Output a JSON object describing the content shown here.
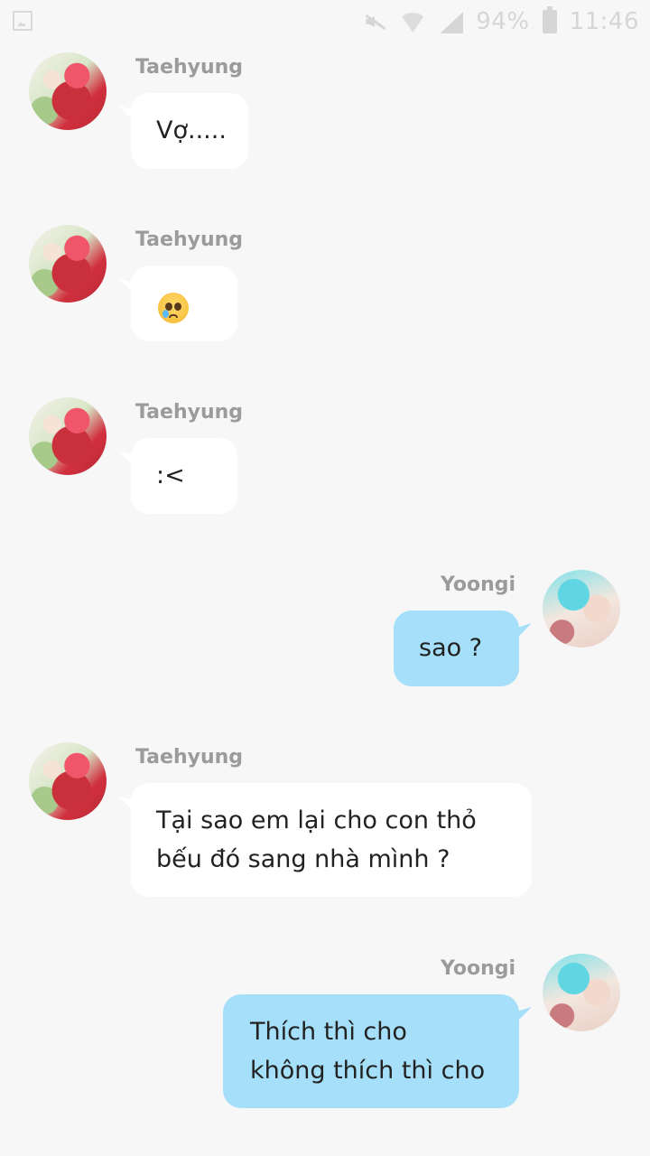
{
  "status_bar": {
    "battery": "94%",
    "time": "11:46",
    "icons": [
      "gallery-icon",
      "mute-icon",
      "wifi-icon",
      "signal-icon",
      "battery-icon"
    ]
  },
  "colors": {
    "background": "#f7f7f7",
    "incoming_bubble": "#ffffff",
    "outgoing_bubble": "#a5dff9",
    "name_text": "#9b9b9b"
  },
  "messages": [
    {
      "sender": "Taehyung",
      "direction": "in",
      "text": "Vợ....."
    },
    {
      "sender": "Taehyung",
      "direction": "in",
      "text": "",
      "emoji": "pleading-crying-face"
    },
    {
      "sender": "Taehyung",
      "direction": "in",
      "text": ":<"
    },
    {
      "sender": "Yoongi",
      "direction": "out",
      "text": "sao  ?"
    },
    {
      "sender": "Taehyung",
      "direction": "in",
      "text": "Tại sao em lại cho con thỏ\nbếu đó sang nhà mình ?"
    },
    {
      "sender": "Yoongi",
      "direction": "out",
      "text": "Thích thì cho\nkhông thích thì cho"
    }
  ]
}
